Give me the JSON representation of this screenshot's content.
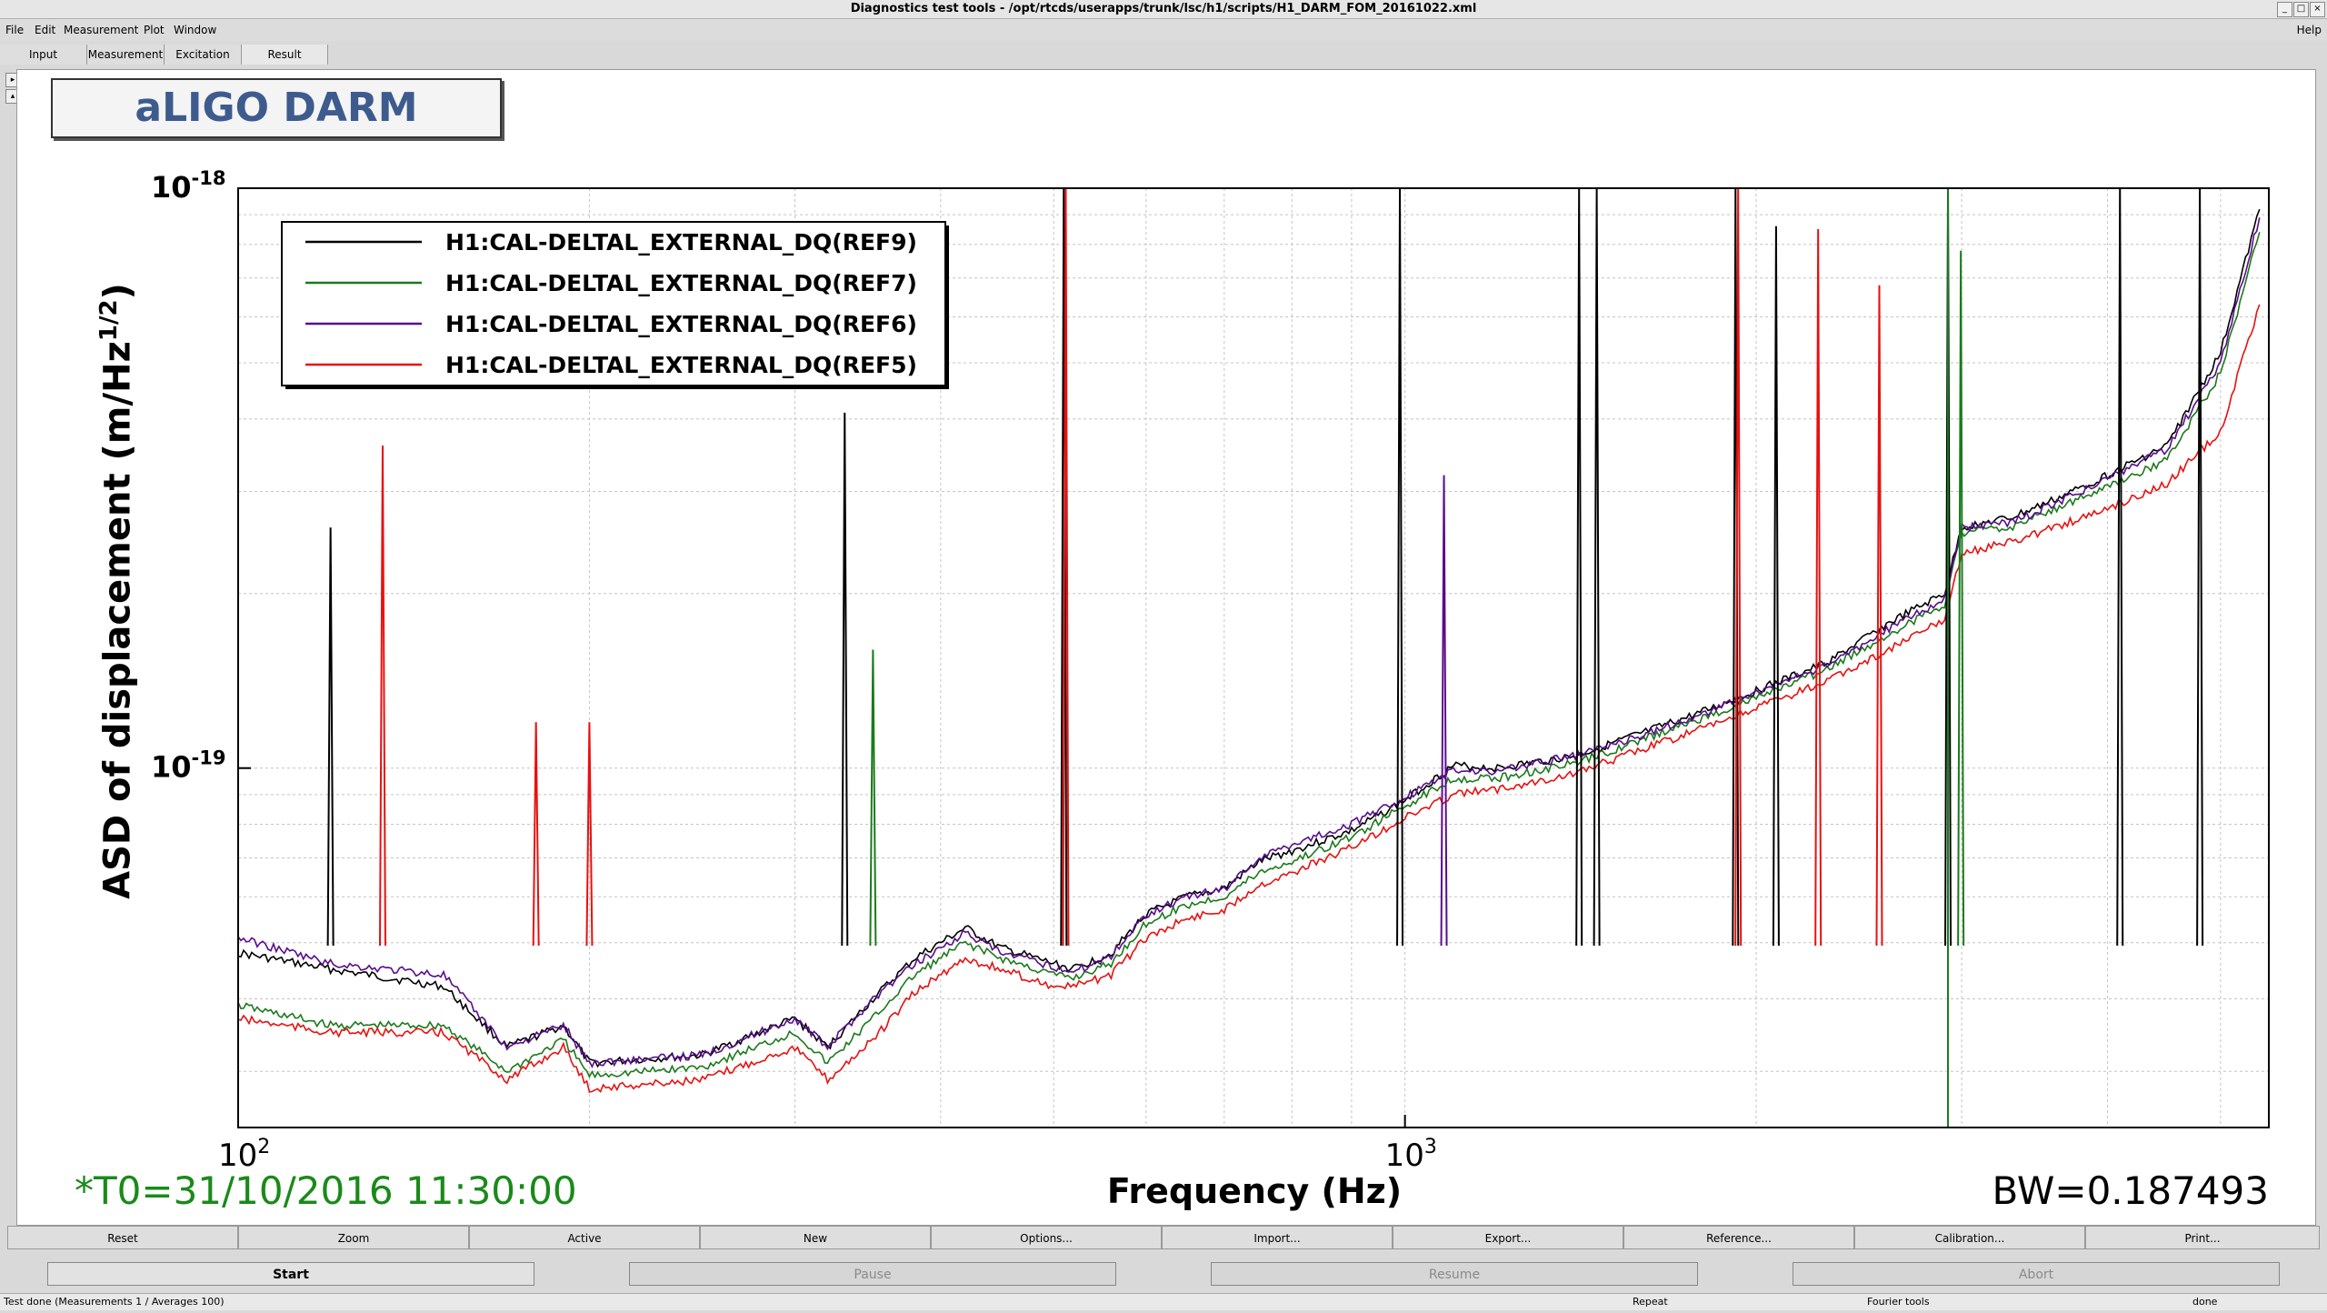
{
  "window": {
    "title": "Diagnostics test tools - /opt/rtcds/userapps/trunk/lsc/h1/scripts/H1_DARM_FOM_20161022.xml"
  },
  "menu": {
    "file": "File",
    "edit": "Edit",
    "measurement": "Measurement",
    "plot": "Plot",
    "window": "Window",
    "help": "Help"
  },
  "tabs": {
    "input": "Input",
    "measurement": "Measurement",
    "excitation": "Excitation",
    "result": "Result"
  },
  "plot": {
    "title": "aLIGO DARM",
    "t0": "*T0=31/10/2016 11:30:00",
    "bw": "BW=0.187493"
  },
  "chart_data": {
    "type": "line",
    "xlabel": "Frequency (Hz)",
    "ylabel_main": "ASD of displacement (m/Hz",
    "ylabel_sup": "1/2",
    "ylabel_end": ")",
    "xscale": "log",
    "yscale": "log",
    "xlim": [
      100,
      5500
    ],
    "ylim": [
      2.4e-20,
      1e-18
    ],
    "x_ticks": [
      {
        "base": "10",
        "exp": "2",
        "value": 100
      },
      {
        "base": "10",
        "exp": "3",
        "value": 1000
      }
    ],
    "y_ticks": [
      {
        "base": "10",
        "exp": "-18",
        "value": 1e-18
      },
      {
        "base": "10",
        "exp": "-19",
        "value": 1e-19
      }
    ],
    "grid": true,
    "legend_position": "top-left",
    "series": [
      {
        "name": "H1:CAL-DELTAL_EXTERNAL_DQ(REF9)",
        "color": "#000000",
        "points": [
          [
            100,
            4.8e-20
          ],
          [
            120,
            4.5e-20
          ],
          [
            150,
            4.2e-20
          ],
          [
            170,
            3.3e-20
          ],
          [
            190,
            3.6e-20
          ],
          [
            200,
            3.1e-20
          ],
          [
            250,
            3.2e-20
          ],
          [
            300,
            3.7e-20
          ],
          [
            320,
            3.3e-20
          ],
          [
            350,
            4e-20
          ],
          [
            380,
            4.7e-20
          ],
          [
            420,
            5.3e-20
          ],
          [
            450,
            4.9e-20
          ],
          [
            500,
            4.6e-20
          ],
          [
            520,
            4.5e-20
          ],
          [
            560,
            4.8e-20
          ],
          [
            600,
            5.6e-20
          ],
          [
            650,
            6e-20
          ],
          [
            700,
            6.2e-20
          ],
          [
            750,
            6.9e-20
          ],
          [
            800,
            7.2e-20
          ],
          [
            900,
            7.8e-20
          ],
          [
            1000,
            8.8e-20
          ],
          [
            1100,
            1.01e-19
          ],
          [
            1200,
            1e-19
          ],
          [
            1400,
            1.05e-19
          ],
          [
            1600,
            1.15e-19
          ],
          [
            1800,
            1.25e-19
          ],
          [
            2000,
            1.36e-19
          ],
          [
            2300,
            1.52e-19
          ],
          [
            2600,
            1.78e-19
          ],
          [
            2900,
            2e-19
          ],
          [
            3000,
            2.6e-19
          ],
          [
            3300,
            2.7e-19
          ],
          [
            3600,
            2.9e-19
          ],
          [
            4000,
            3.2e-19
          ],
          [
            4500,
            3.6e-19
          ],
          [
            5000,
            5.2e-19
          ],
          [
            5400,
            9.2e-19
          ]
        ]
      },
      {
        "name": "H1:CAL-DELTAL_EXTERNAL_DQ(REF7)",
        "color": "#1b7a1b",
        "points": [
          [
            100,
            3.9e-20
          ],
          [
            120,
            3.6e-20
          ],
          [
            150,
            3.6e-20
          ],
          [
            170,
            3e-20
          ],
          [
            190,
            3.4e-20
          ],
          [
            200,
            2.95e-20
          ],
          [
            250,
            3.05e-20
          ],
          [
            300,
            3.5e-20
          ],
          [
            320,
            3.1e-20
          ],
          [
            350,
            3.7e-20
          ],
          [
            380,
            4.4e-20
          ],
          [
            420,
            5e-20
          ],
          [
            450,
            4.7e-20
          ],
          [
            500,
            4.4e-20
          ],
          [
            520,
            4.35e-20
          ],
          [
            560,
            4.6e-20
          ],
          [
            600,
            5.4e-20
          ],
          [
            650,
            5.8e-20
          ],
          [
            700,
            6e-20
          ],
          [
            750,
            6.6e-20
          ],
          [
            800,
            6.9e-20
          ],
          [
            900,
            7.6e-20
          ],
          [
            1000,
            8.6e-20
          ],
          [
            1100,
            9.6e-20
          ],
          [
            1200,
            9.6e-20
          ],
          [
            1400,
            1.02e-19
          ],
          [
            1600,
            1.12e-19
          ],
          [
            1800,
            1.22e-19
          ],
          [
            2000,
            1.32e-19
          ],
          [
            2300,
            1.48e-19
          ],
          [
            2600,
            1.7e-19
          ],
          [
            2900,
            1.92e-19
          ],
          [
            3000,
            2.55e-19
          ],
          [
            3300,
            2.6e-19
          ],
          [
            3600,
            2.8e-19
          ],
          [
            4000,
            3.05e-19
          ],
          [
            4500,
            3.4e-19
          ],
          [
            5000,
            4.8e-19
          ],
          [
            5400,
            8.4e-19
          ]
        ]
      },
      {
        "name": "H1:CAL-DELTAL_EXTERNAL_DQ(REF6)",
        "color": "#5a0c8c",
        "points": [
          [
            100,
            5.1e-20
          ],
          [
            120,
            4.6e-20
          ],
          [
            150,
            4.4e-20
          ],
          [
            170,
            3.3e-20
          ],
          [
            190,
            3.6e-20
          ],
          [
            200,
            3.1e-20
          ],
          [
            250,
            3.2e-20
          ],
          [
            300,
            3.7e-20
          ],
          [
            320,
            3.3e-20
          ],
          [
            350,
            4e-20
          ],
          [
            380,
            4.6e-20
          ],
          [
            420,
            5.2e-20
          ],
          [
            450,
            4.8e-20
          ],
          [
            500,
            4.55e-20
          ],
          [
            520,
            4.45e-20
          ],
          [
            560,
            4.75e-20
          ],
          [
            600,
            5.6e-20
          ],
          [
            650,
            6e-20
          ],
          [
            700,
            6.2e-20
          ],
          [
            750,
            7e-20
          ],
          [
            800,
            7.4e-20
          ],
          [
            900,
            8e-20
          ],
          [
            1000,
            8.9e-20
          ],
          [
            1100,
            9.9e-20
          ],
          [
            1200,
            9.9e-20
          ],
          [
            1400,
            1.05e-19
          ],
          [
            1600,
            1.14e-19
          ],
          [
            1800,
            1.24e-19
          ],
          [
            2000,
            1.35e-19
          ],
          [
            2300,
            1.5e-19
          ],
          [
            2600,
            1.74e-19
          ],
          [
            2900,
            1.96e-19
          ],
          [
            3000,
            2.6e-19
          ],
          [
            3300,
            2.65e-19
          ],
          [
            3600,
            2.85e-19
          ],
          [
            4000,
            3.15e-19
          ],
          [
            4500,
            3.55e-19
          ],
          [
            5000,
            5e-19
          ],
          [
            5400,
            8.9e-19
          ]
        ]
      },
      {
        "name": "H1:CAL-DELTAL_EXTERNAL_DQ(REF5)",
        "color": "#e81010",
        "points": [
          [
            100,
            3.7e-20
          ],
          [
            120,
            3.5e-20
          ],
          [
            150,
            3.5e-20
          ],
          [
            170,
            2.9e-20
          ],
          [
            190,
            3.3e-20
          ],
          [
            200,
            2.8e-20
          ],
          [
            250,
            2.9e-20
          ],
          [
            300,
            3.3e-20
          ],
          [
            320,
            2.9e-20
          ],
          [
            350,
            3.4e-20
          ],
          [
            380,
            4.1e-20
          ],
          [
            420,
            4.7e-20
          ],
          [
            450,
            4.5e-20
          ],
          [
            500,
            4.2e-20
          ],
          [
            520,
            4.2e-20
          ],
          [
            560,
            4.4e-20
          ],
          [
            600,
            5.1e-20
          ],
          [
            650,
            5.5e-20
          ],
          [
            700,
            5.7e-20
          ],
          [
            750,
            6.3e-20
          ],
          [
            800,
            6.6e-20
          ],
          [
            900,
            7.3e-20
          ],
          [
            1000,
            8.2e-20
          ],
          [
            1100,
            9e-20
          ],
          [
            1200,
            9.2e-20
          ],
          [
            1400,
            9.8e-20
          ],
          [
            1600,
            1.08e-19
          ],
          [
            1800,
            1.17e-19
          ],
          [
            2000,
            1.27e-19
          ],
          [
            2300,
            1.41e-19
          ],
          [
            2600,
            1.6e-19
          ],
          [
            2900,
            1.8e-19
          ],
          [
            3000,
            2.35e-19
          ],
          [
            3300,
            2.45e-19
          ],
          [
            3600,
            2.6e-19
          ],
          [
            4000,
            2.8e-19
          ],
          [
            4500,
            3.1e-19
          ],
          [
            5000,
            3.8e-19
          ],
          [
            5400,
            6.3e-19
          ]
        ]
      }
    ],
    "peaks": [
      {
        "x": 120,
        "y": 2.6e-19,
        "color": "#000000"
      },
      {
        "x": 133,
        "y": 3.6e-19,
        "color": "#e81010"
      },
      {
        "x": 180,
        "y": 1.2e-19,
        "color": "#e81010"
      },
      {
        "x": 200,
        "y": 1.2e-19,
        "color": "#e81010"
      },
      {
        "x": 331,
        "y": 4.1e-19,
        "color": "#000000"
      },
      {
        "x": 350,
        "y": 1.6e-19,
        "color": "#1b7a1b"
      },
      {
        "x": 510,
        "y": 1e-18,
        "color": "#000000"
      },
      {
        "x": 512,
        "y": 1e-18,
        "color": "#e81010"
      },
      {
        "x": 990,
        "y": 1e-18,
        "color": "#000000"
      },
      {
        "x": 1080,
        "y": 3.2e-19,
        "color": "#5a0c8c"
      },
      {
        "x": 1410,
        "y": 1e-18,
        "color": "#000000"
      },
      {
        "x": 1460,
        "y": 1e-18,
        "color": "#000000"
      },
      {
        "x": 1920,
        "y": 1e-18,
        "color": "#000000"
      },
      {
        "x": 1930,
        "y": 1e-18,
        "color": "#e81010"
      },
      {
        "x": 2080,
        "y": 8.6e-19,
        "color": "#000000"
      },
      {
        "x": 2260,
        "y": 8.5e-19,
        "color": "#e81010"
      },
      {
        "x": 2550,
        "y": 6.8e-19,
        "color": "#e81010"
      },
      {
        "x": 2920,
        "y": 1e-18,
        "color": "#000000"
      },
      {
        "x": 2995,
        "y": 7.8e-19,
        "color": "#1b7a1b"
      },
      {
        "x": 4100,
        "y": 1e-18,
        "color": "#000000"
      },
      {
        "x": 4800,
        "y": 1e-18,
        "color": "#000000"
      }
    ],
    "vertical_line": {
      "x": 2920,
      "color": "#1b7a1b"
    }
  },
  "toolbar": {
    "reset": "Reset",
    "zoom": "Zoom",
    "active": "Active",
    "new": "New",
    "options": "Options...",
    "import": "Import...",
    "export": "Export...",
    "reference": "Reference...",
    "calibration": "Calibration...",
    "print": "Print..."
  },
  "controls": {
    "start": "Start",
    "pause": "Pause",
    "resume": "Resume",
    "abort": "Abort"
  },
  "status": {
    "left": "Test done (Measurements 1 / Averages 100)",
    "repeat": "Repeat",
    "fourier": "Fourier tools",
    "done": "done"
  }
}
